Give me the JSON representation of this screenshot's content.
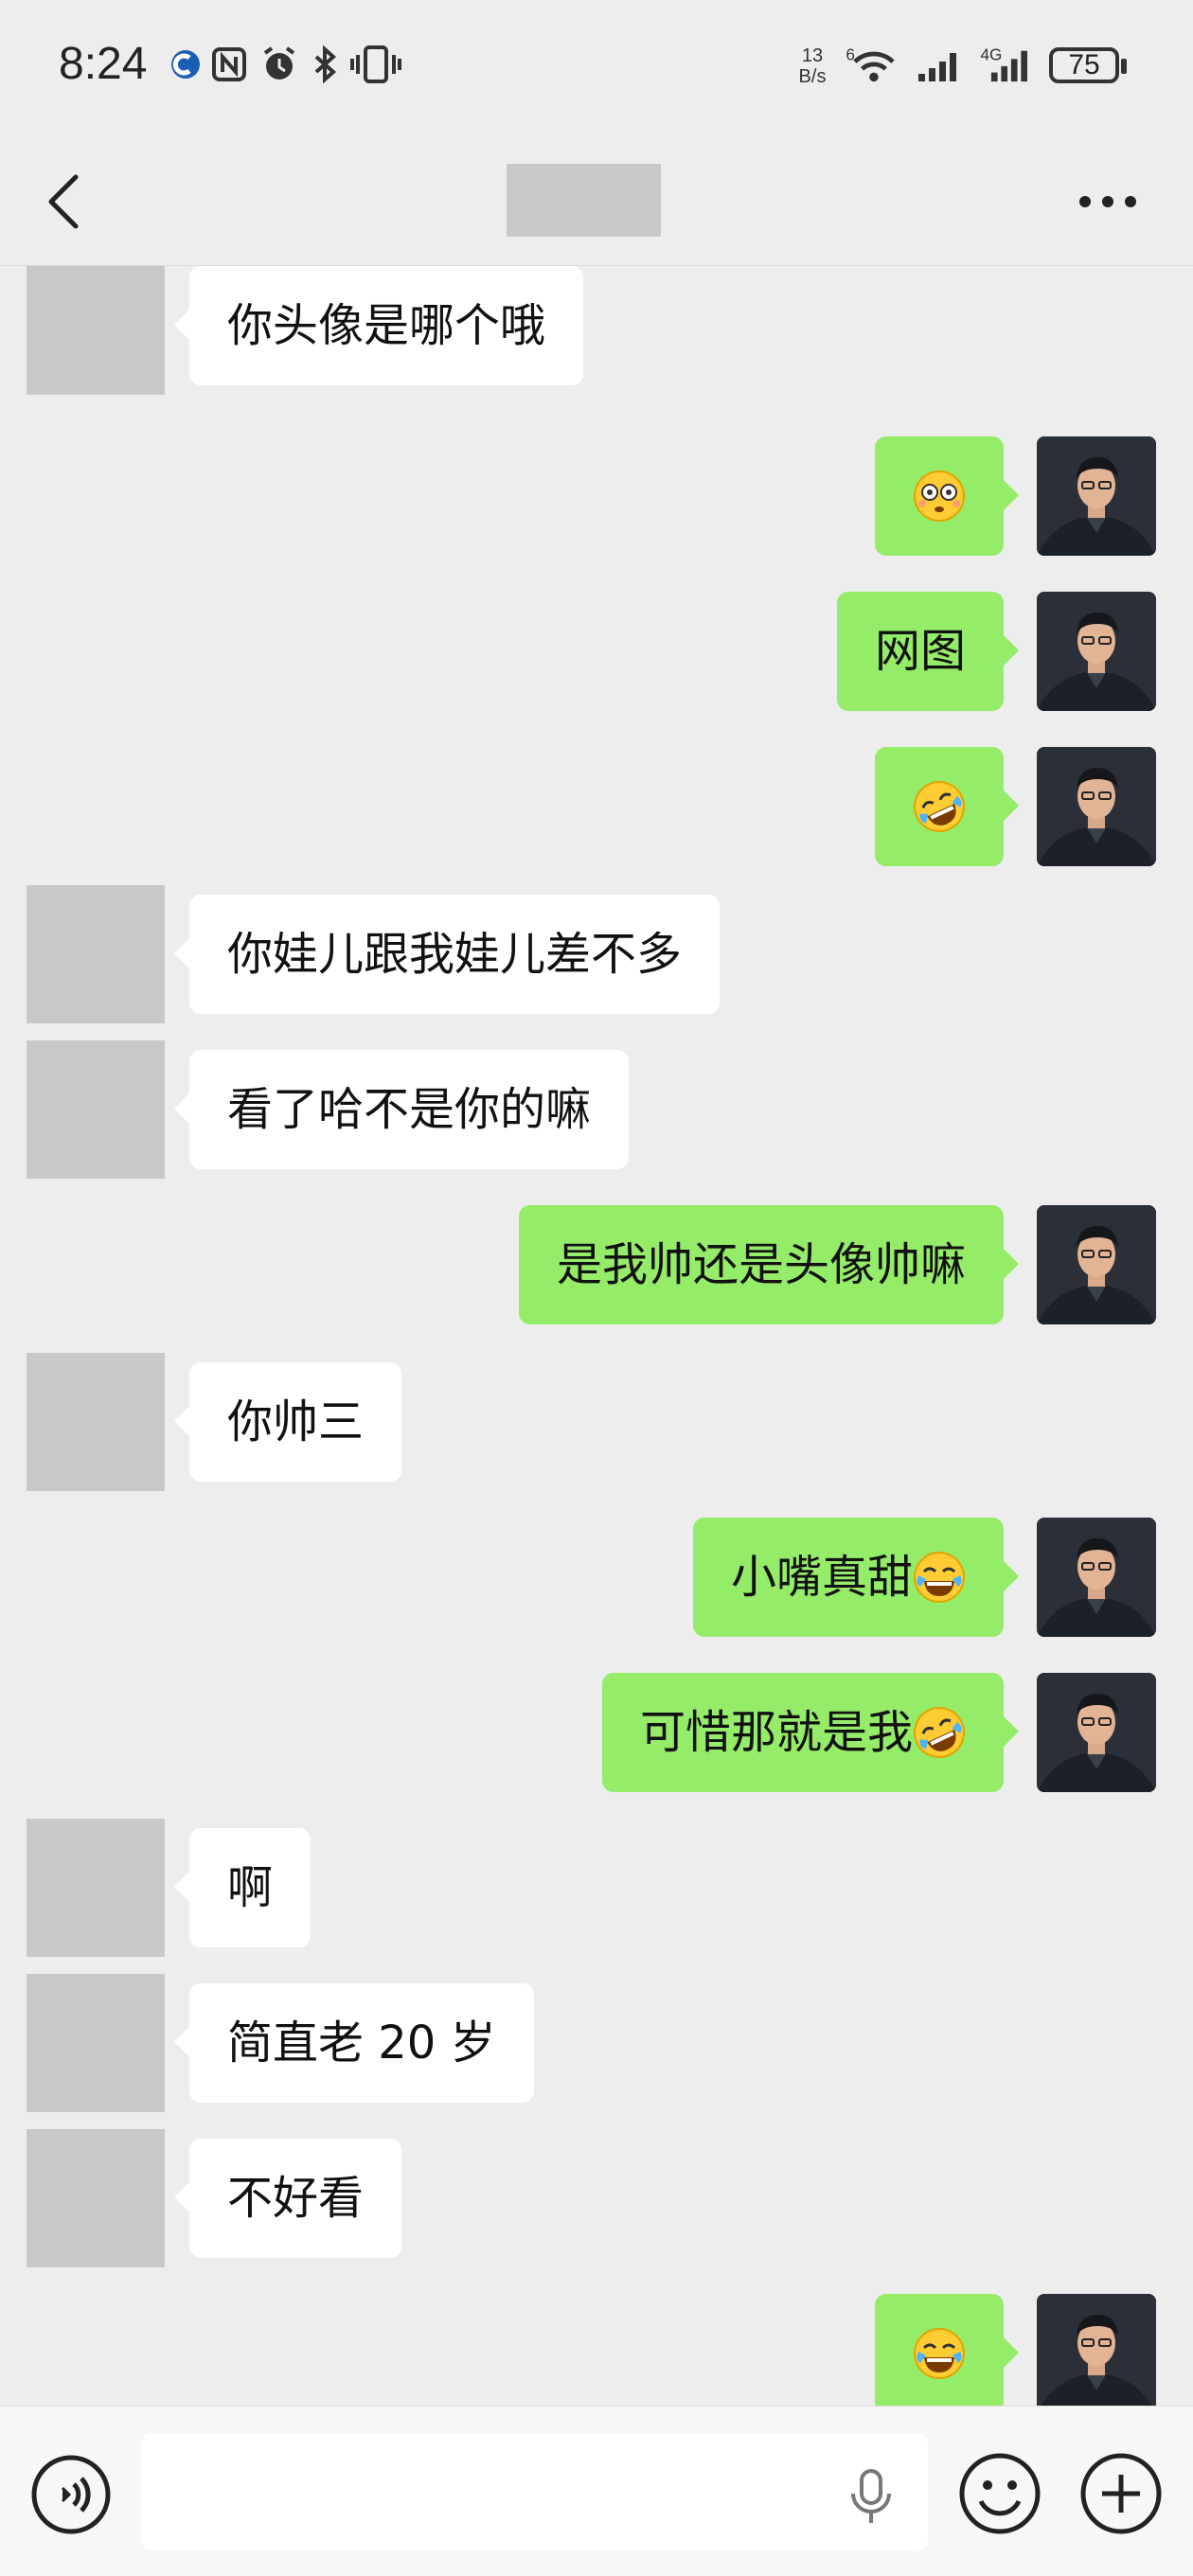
{
  "status_bar": {
    "time": "8:24",
    "net_speed_value": "13",
    "net_speed_unit": "B/s",
    "wifi_label": "6",
    "signal_label": "4G",
    "battery": "75",
    "icons": [
      "app-badge-icon",
      "nfc-icon",
      "alarm-icon",
      "bluetooth-icon",
      "vibrate-icon",
      "wifi-icon",
      "signal-icon",
      "signal-4g-icon",
      "battery-icon"
    ]
  },
  "header": {
    "back_icon": "chevron-left-icon",
    "more_icon": "more-dots-icon"
  },
  "messages": [
    {
      "side": "in",
      "text": "你头像是哪个哦"
    },
    {
      "side": "out",
      "text": "",
      "emoji": "flushed"
    },
    {
      "side": "out",
      "text": "网图"
    },
    {
      "side": "out",
      "text": "",
      "emoji": "rofl"
    },
    {
      "side": "in",
      "text": "你娃儿跟我娃儿差不多"
    },
    {
      "side": "in",
      "text": "看了哈不是你的嘛"
    },
    {
      "side": "out",
      "text": "是我帅还是头像帅嘛"
    },
    {
      "side": "in",
      "text": "你帅三"
    },
    {
      "side": "out",
      "text": "小嘴真甜",
      "emoji": "joy"
    },
    {
      "side": "out",
      "text": "可惜那就是我",
      "emoji": "rofl"
    },
    {
      "side": "in",
      "text": "啊"
    },
    {
      "side": "in",
      "text": "简直老 20 岁"
    },
    {
      "side": "in",
      "text": "不好看"
    },
    {
      "side": "out",
      "text": "",
      "emoji": "joy"
    }
  ],
  "input_bar": {
    "voice_icon": "voice-mode-icon",
    "mic_icon": "microphone-icon",
    "emoji_icon": "emoji-smile-icon",
    "plus_icon": "plus-circle-icon"
  }
}
